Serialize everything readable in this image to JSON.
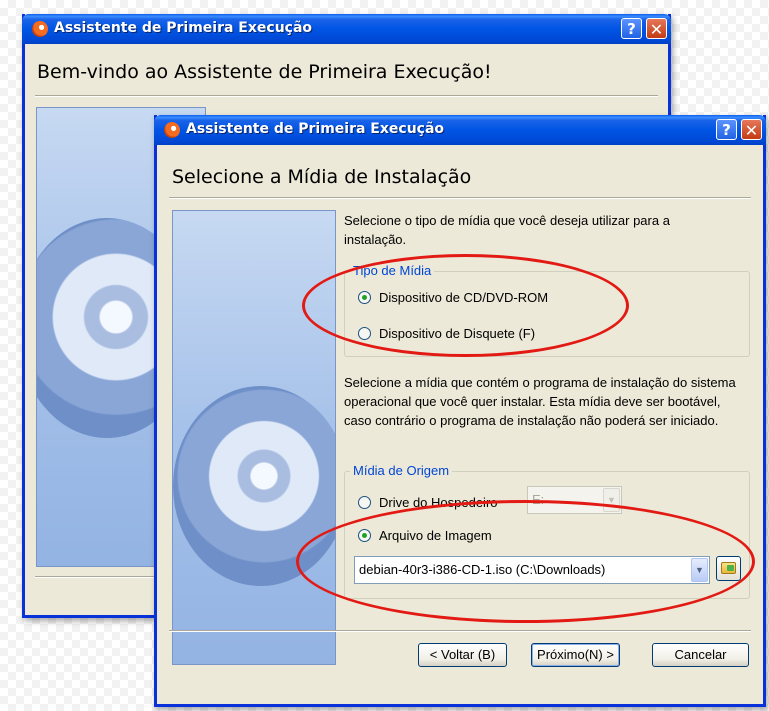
{
  "background_window": {
    "title": "Assistente de Primeira Execução",
    "heading": "Bem-vindo ao Assistente de Primeira Execução!",
    "help_label": "?",
    "close_label": "✕"
  },
  "dialog": {
    "title": "Assistente de Primeira Execução",
    "help_label": "?",
    "close_label": "✕",
    "heading": "Selecione a Mídia de Instalação",
    "intro_text": "Selecione o tipo de mídia que você deseja utilizar para a instalação.",
    "media_type": {
      "legend": "Tipo de Mídia",
      "options": [
        {
          "label": "Dispositivo de CD/DVD-ROM",
          "checked": true
        },
        {
          "label": "Dispositivo de Disquete (F)",
          "checked": false
        }
      ]
    },
    "source_text": "Selecione a mídia que contém o programa de instalação do sistema operacional que você quer instalar. Esta mídia deve ser bootável, caso contrário o programa de instalação não poderá ser iniciado.",
    "source_media": {
      "legend": "Mídia de Origem",
      "host_drive_label": "Drive do Hospedeiro",
      "host_drive_value": "E:",
      "host_drive_checked": false,
      "image_file_label": "Arquivo de Imagem",
      "image_file_checked": true,
      "image_file_value": "debian-40r3-i386-CD-1.iso (C:\\Downloads)"
    },
    "buttons": {
      "back": "< Voltar (B)",
      "next": "Próximo(N) >",
      "cancel": "Cancelar"
    }
  },
  "colors": {
    "xp_title_blue": "#0055e5",
    "window_face": "#ece9d8",
    "highlight_ellipse": "#e21a13",
    "groupbox_legend": "#0046d5"
  },
  "icons": {
    "app": "virtualbox-icon",
    "illustration": "hard-disk-illustration",
    "browse": "folder-open-icon"
  }
}
